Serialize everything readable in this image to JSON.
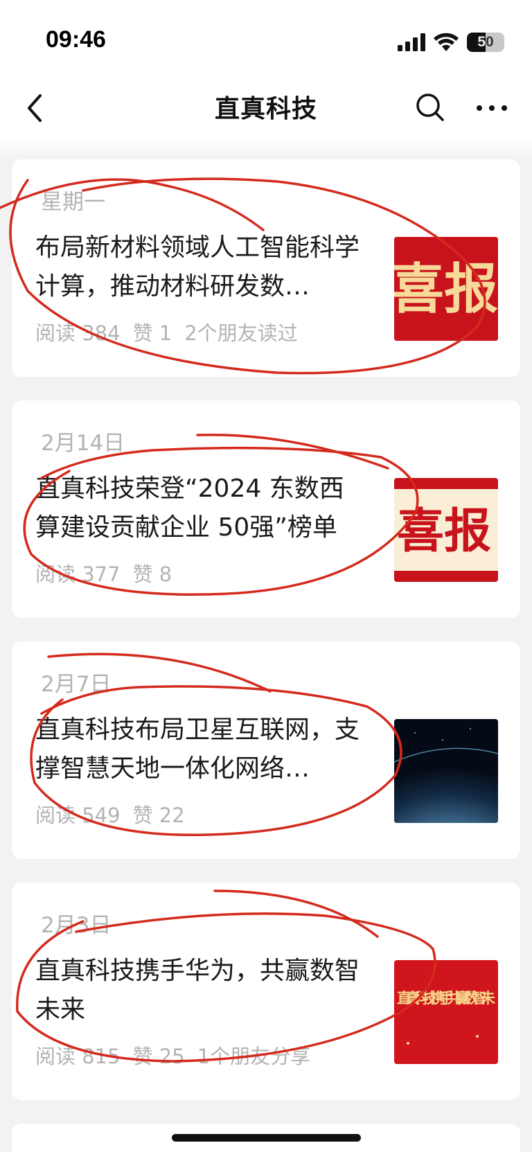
{
  "status_bar": {
    "time": "09:46",
    "battery": "50"
  },
  "nav": {
    "title": "直真科技",
    "icons": [
      "back-icon",
      "search-icon",
      "more-icon"
    ]
  },
  "articles": [
    {
      "date": "星期一",
      "title": "布局新材料领域人工智能科学计算，推动材料研发数…",
      "read": "阅读 384",
      "likes": "赞 1",
      "extra": "2个朋友读过",
      "thumb_text": "喜报",
      "thumb_color": "#c8131c"
    },
    {
      "date": "2月14日",
      "title": "直真科技荣登“2024 东数西算建设贡献企业 50强”榜单",
      "read": "阅读 377",
      "likes": "赞 8",
      "extra": "",
      "thumb_text": "喜报",
      "thumb_color": "#c8131c"
    },
    {
      "date": "2月7日",
      "title": "直真科技布局卫星互联网，支撑智慧天地一体化网络…",
      "read": "阅读 549",
      "likes": "赞 22",
      "extra": "",
      "thumb_text": "",
      "thumb_color": "#0a1a2e"
    },
    {
      "date": "2月3日",
      "title": "直真科技携手华为，共赢数智未来",
      "read": "阅读 815",
      "likes": "赞 25",
      "extra": "1个朋友分享",
      "thumb_text": "直真科技携手 共赢数智未",
      "thumb_color": "#d0151c"
    }
  ],
  "annotation_color": "#d42a1e"
}
